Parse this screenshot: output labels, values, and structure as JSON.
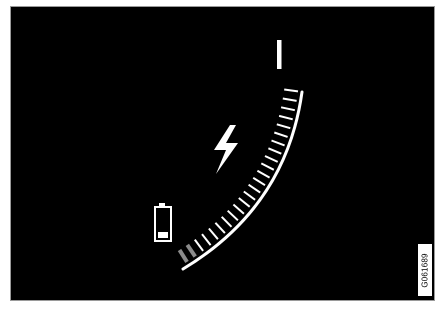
{
  "display": {
    "background_color": "#000000",
    "foreground_color": "#ffffff",
    "inactive_tick_color": "#8a8a8a"
  },
  "gauge": {
    "type": "battery-charge-level",
    "charge_fraction": 0.1,
    "icons": [
      "charging-bolt-icon",
      "battery-low-icon"
    ]
  },
  "figure_code": "G061689"
}
